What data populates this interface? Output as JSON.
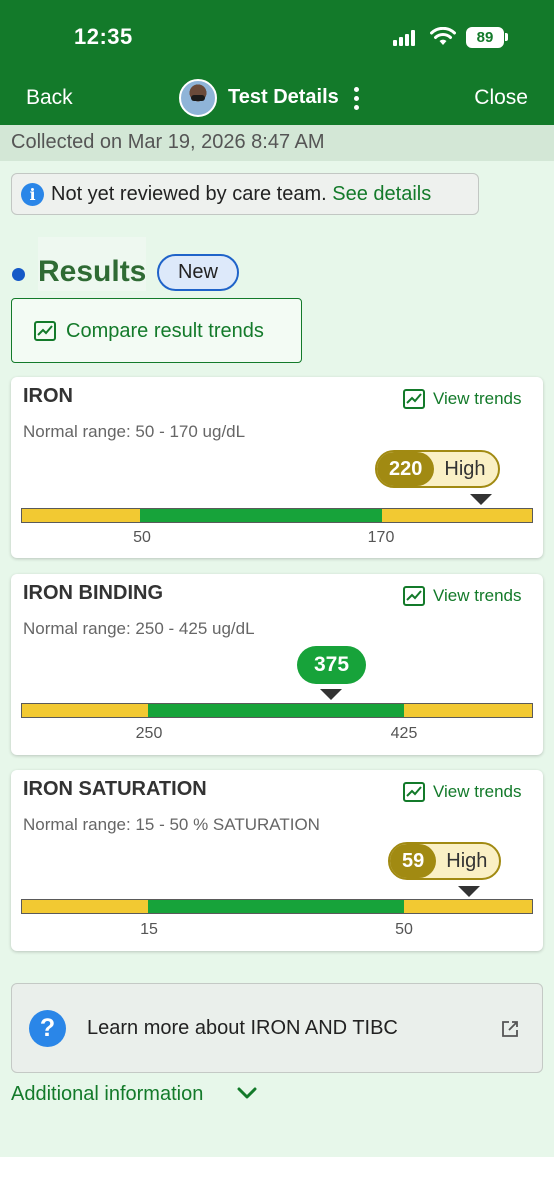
{
  "status_bar": {
    "time": "12:35",
    "battery": "89"
  },
  "nav": {
    "back": "Back",
    "title": "Test Details",
    "close": "Close"
  },
  "collected": "Collected on Mar 19, 2026 8:47 AM",
  "review": {
    "text": "Not yet reviewed by care team.",
    "link": "See details"
  },
  "results": {
    "title": "Results",
    "badge": "New",
    "compare_label": "Compare result trends",
    "view_trends_label": "View trends",
    "items": [
      {
        "name": "IRON",
        "normal_range": "Normal range: 50 - 170 ug/dL",
        "value": "220",
        "flag": "High",
        "low": "50",
        "high": "170"
      },
      {
        "name": "IRON BINDING",
        "normal_range": "Normal range: 250 - 425 ug/dL",
        "value": "375",
        "flag": "",
        "low": "250",
        "high": "425"
      },
      {
        "name": "IRON SATURATION",
        "normal_range": "Normal range: 15 - 50 % SATURATION",
        "value": "59",
        "flag": "High",
        "low": "15",
        "high": "50"
      }
    ]
  },
  "learn_more": "Learn more about IRON AND TIBC",
  "additional": "Additional information",
  "colors": {
    "header": "#137a2a",
    "in_range": "#17a33a",
    "out_of_range": "#f2c932",
    "high_flag": "#a18a12"
  },
  "icons": [
    "signal-icon",
    "wifi-icon",
    "battery-icon",
    "info-icon",
    "trend-chart-icon",
    "question-icon",
    "external-link-icon",
    "chevron-down-icon",
    "more-vertical-icon"
  ]
}
